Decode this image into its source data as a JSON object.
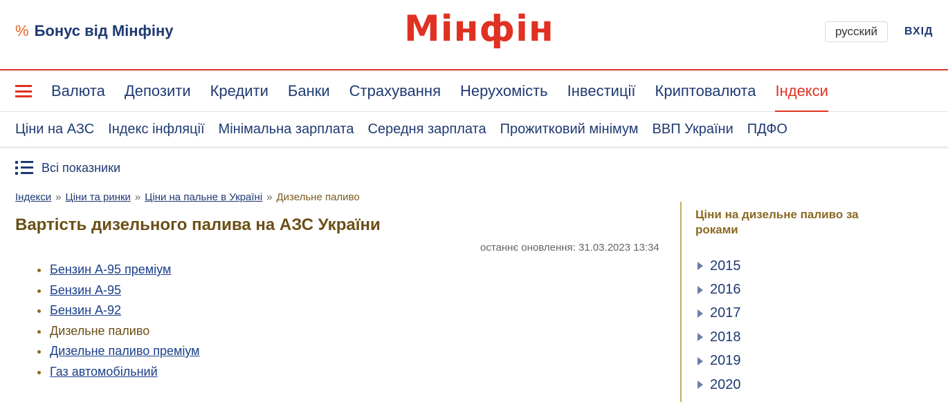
{
  "header": {
    "bonus_icon": "%",
    "bonus_label": "Бонус від Мінфіну",
    "logo": "Мінфін",
    "language_button": "русский",
    "login_button": "ВХІД"
  },
  "main_nav": {
    "items": [
      "Валюта",
      "Депозити",
      "Кредити",
      "Банки",
      "Страхування",
      "Нерухомість",
      "Інвестиції",
      "Криптовалюта",
      "Індекси"
    ],
    "active": "Індекси"
  },
  "sub_nav": {
    "items": [
      "Ціни на АЗС",
      "Індекс інфляції",
      "Мінімальна зарплата",
      "Середня зарплата",
      "Прожитковий мінімум",
      "ВВП України",
      "ПДФО"
    ]
  },
  "all_indicators": "Всі показники",
  "breadcrumb": {
    "links": [
      "Індекси",
      "Ціни та ринки",
      "Ціни на пальне в Україні"
    ],
    "separator": "»",
    "current": "Дизельне паливо"
  },
  "page_title": "Вартість дизельного палива на АЗС України",
  "last_updated": "останнє оновлення: 31.03.2023 13:34",
  "fuel_types": [
    {
      "label": "Бензин А-95 преміум",
      "link": true
    },
    {
      "label": "Бензин А-95",
      "link": true
    },
    {
      "label": "Бензин А-92",
      "link": true
    },
    {
      "label": "Дизельне паливо",
      "link": false
    },
    {
      "label": "Дизельне паливо преміум",
      "link": true
    },
    {
      "label": "Газ автомобільний",
      "link": true
    }
  ],
  "sidebar": {
    "heading": "Ціни на дизельне паливо за роками",
    "years": [
      "2015",
      "2016",
      "2017",
      "2018",
      "2019",
      "2020"
    ]
  },
  "colors": {
    "brand_red": "#e03122",
    "nav_blue": "#1f3a72",
    "title_brown": "#6b4f16"
  }
}
